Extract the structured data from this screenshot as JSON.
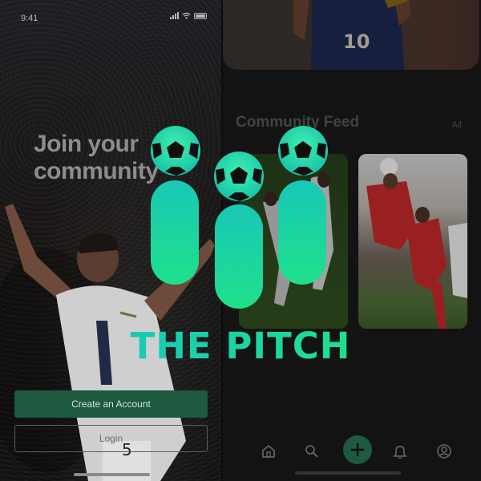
{
  "status_bar": {
    "time": "9:41"
  },
  "onboarding": {
    "headline": "Join your community",
    "create_account_label": "Create an Account",
    "login_label": "Login"
  },
  "feed": {
    "section_title": "Community Feed",
    "see_all_label": "All",
    "hero_jersey_number": "10"
  },
  "nav": {
    "items": [
      "home-icon",
      "search-icon",
      "add-icon",
      "bell-icon",
      "profile-icon"
    ]
  },
  "logo": {
    "wordmark": "THE PITCH"
  },
  "colors": {
    "accent_green": "#1d5a40",
    "logo_gradient_start": "#19c8b6",
    "logo_gradient_end": "#1fe08c",
    "background": "#131313"
  }
}
